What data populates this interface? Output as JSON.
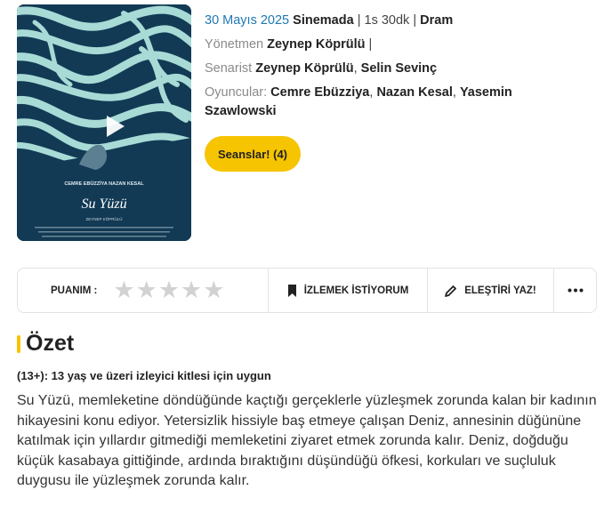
{
  "poster": {
    "title_script": "Su Yüzü",
    "cast_line": "CEMRE EBÜZZİYA    NAZAN KESAL",
    "director_line": "ZEYNEP KÖPRÜLÜ"
  },
  "meta": {
    "date": "30 Mayıs 2025",
    "status": "Sinemada",
    "duration": "1s 30dk",
    "genre": "Dram",
    "separator": "|",
    "director_label": "Yönetmen",
    "director": "Zeynep Köprülü",
    "writer_label": "Senarist",
    "writers": [
      "Zeynep Köprülü",
      "Selin Sevinç"
    ],
    "cast_label": "Oyuncular:",
    "cast": [
      "Cemre Ebüzziya",
      "Nazan Kesal",
      "Yasemin Szawlowski"
    ],
    "list_separator": ","
  },
  "showtimes_button": "Seanslar! (4)",
  "action_bar": {
    "rating_label": "PUANIM :",
    "stars_total": 5,
    "stars_filled": 0,
    "watchlist_label": "İZLEMEK İSTİYORUM",
    "critic_label": "ELEŞTİRİ YAZ!",
    "more_icon": "more-dots-icon"
  },
  "summary": {
    "heading": "Özet",
    "age_rating": "(13+): 13 yaş ve üzeri izleyici kitlesi için uygun",
    "text": "Su Yüzü, memleketine döndüğünde kaçtığı gerçeklerle yüzleşmek zorunda kalan bir kadının hikayesini konu ediyor. Yetersizlik hissiyle baş etmeye çalışan Deniz, annesinin düğününe katılmak için yıllardır gitmediği memleketini ziyaret etmek zorunda kalır. Deniz, doğduğu küçük kasabaya gittiğinde, ardında bıraktığını düşündüğü öfkesi, korkuları ve suçluluk duygusu ile yüzleşmek zorunda kalır."
  },
  "colors": {
    "accent": "#f6c400",
    "date_blue": "#1f78b4",
    "poster_dark": "#123a55",
    "poster_light": "#a8dbd6"
  }
}
